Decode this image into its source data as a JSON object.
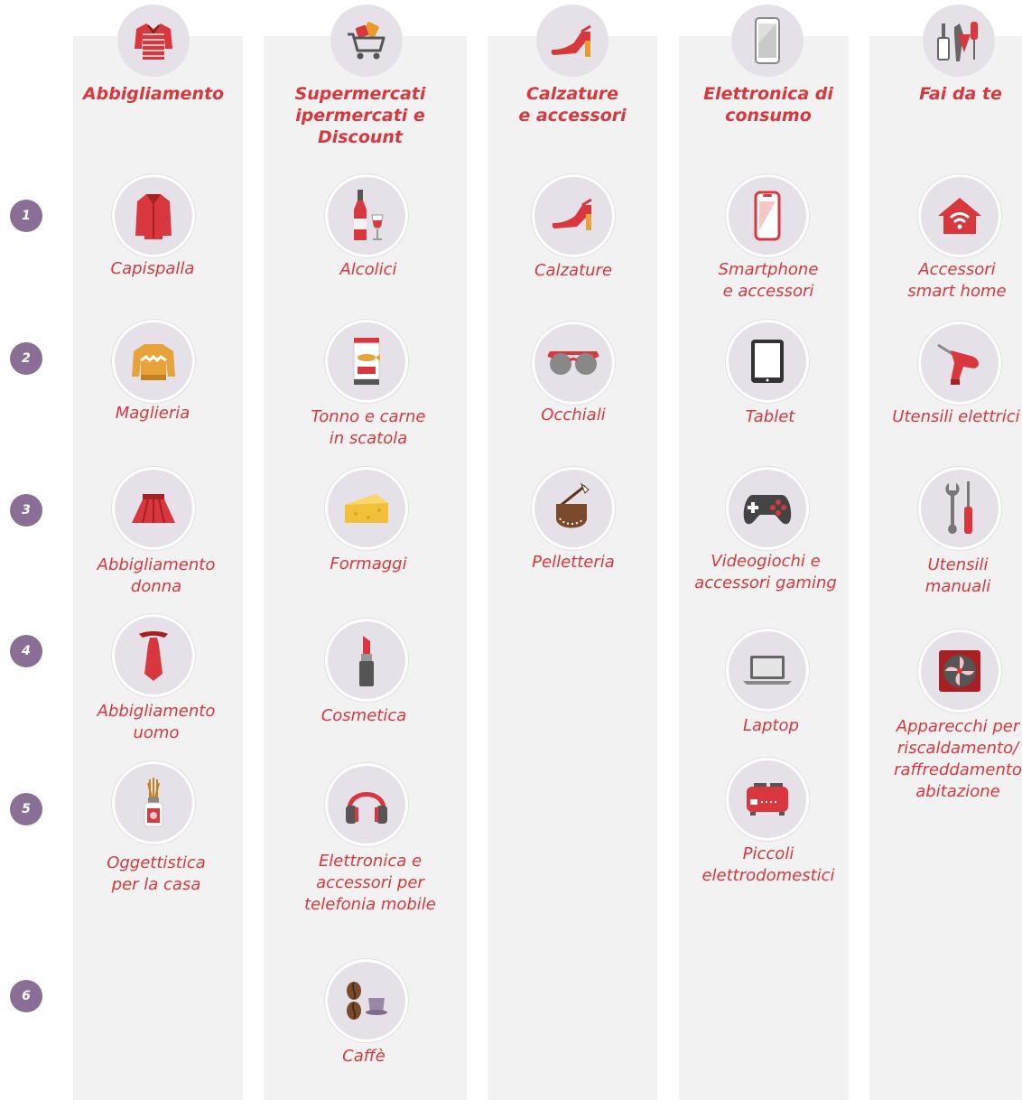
{
  "ranks": [
    "1",
    "2",
    "3",
    "4",
    "5",
    "6"
  ],
  "categories": [
    {
      "title": "Abbigliamento",
      "icon": "sweater-icon",
      "items": [
        {
          "label": "Capispalla",
          "icon": "coat-icon"
        },
        {
          "label": "Maglieria",
          "icon": "pullover-icon"
        },
        {
          "label": "Abbigliamento\ndonna",
          "icon": "skirt-icon"
        },
        {
          "label": "Abbigliamento\nuomo",
          "icon": "tie-icon"
        },
        {
          "label": "Oggettistica\nper la casa",
          "icon": "diffuser-icon"
        }
      ]
    },
    {
      "title": "Supermercati\nipermercati e\nDiscount",
      "icon": "shopping-cart-icon",
      "items": [
        {
          "label": "Alcolici",
          "icon": "wine-icon"
        },
        {
          "label": "Tonno e carne\nin scatola",
          "icon": "canned-fish-icon"
        },
        {
          "label": "Formaggi",
          "icon": "cheese-icon"
        },
        {
          "label": "Cosmetica",
          "icon": "lipstick-icon"
        },
        {
          "label": "Elettronica e\naccessori per\ntelefonia mobile",
          "icon": "headphones-icon"
        },
        {
          "label": "Caffè",
          "icon": "coffee-icon"
        }
      ]
    },
    {
      "title": "Calzature\ne accessori",
      "icon": "high-heel-icon",
      "items": [
        {
          "label": "Calzature",
          "icon": "shoe-icon"
        },
        {
          "label": "Occhiali",
          "icon": "sunglasses-icon"
        },
        {
          "label": "Pelletteria",
          "icon": "bag-icon"
        }
      ]
    },
    {
      "title": "Elettronica di\nconsumo",
      "icon": "phone-icon",
      "items": [
        {
          "label": "Smartphone\ne accessori",
          "icon": "smartphone-icon"
        },
        {
          "label": "Tablet",
          "icon": "tablet-icon"
        },
        {
          "label": "Videogiochi e\naccessori gaming",
          "icon": "gamepad-icon"
        },
        {
          "label": "Laptop",
          "icon": "laptop-icon"
        },
        {
          "label": "Piccoli\nelettrodomestici",
          "icon": "toaster-icon"
        }
      ]
    },
    {
      "title": "Fai da te",
      "icon": "tools-icon",
      "items": [
        {
          "label": "Accessori\nsmart home",
          "icon": "smart-home-icon"
        },
        {
          "label": "Utensili elettrici",
          "icon": "drill-icon"
        },
        {
          "label": "Utensili\nmanuali",
          "icon": "wrench-screwdriver-icon"
        },
        {
          "label": "Apparecchi per\nriscaldamento/\nraffreddamento\nabitazione",
          "icon": "fan-heater-icon"
        }
      ]
    }
  ],
  "colors": {
    "accent": "#d8383d",
    "rank_badge": "#8a6e96",
    "icon_circle": "#e6e1e8",
    "column_bg": "#f2f2f2"
  }
}
